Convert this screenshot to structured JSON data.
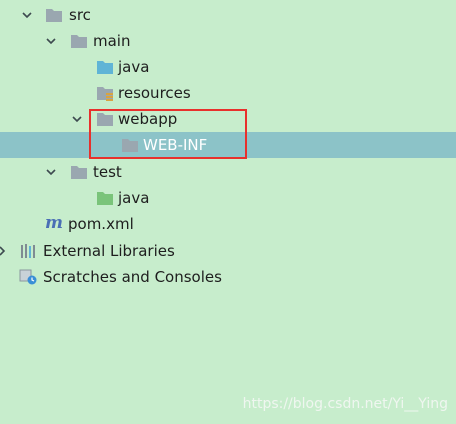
{
  "tree": {
    "items": [
      {
        "label": "src",
        "expanded": true,
        "icon": "folder-icon"
      },
      {
        "label": "main",
        "expanded": true,
        "icon": "folder-icon"
      },
      {
        "label": "java",
        "icon": "source-folder-icon"
      },
      {
        "label": "resources",
        "icon": "resources-folder-icon"
      },
      {
        "label": "webapp",
        "expanded": true,
        "icon": "folder-icon"
      },
      {
        "label": "WEB-INF",
        "icon": "folder-icon",
        "selected": true
      },
      {
        "label": "test",
        "expanded": true,
        "icon": "folder-icon"
      },
      {
        "label": "java",
        "icon": "test-source-folder-icon"
      },
      {
        "label": "pom.xml",
        "icon": "maven-icon"
      },
      {
        "label": "External Libraries",
        "expanded": false,
        "icon": "libraries-icon"
      },
      {
        "label": "Scratches and Consoles",
        "icon": "scratches-icon"
      }
    ]
  },
  "watermark": "https://blog.csdn.net/Yi__Ying",
  "colors": {
    "background": "#c7edcc",
    "selection": "#8cc3c8",
    "highlight_border": "#e8302c",
    "folder": "#9aa7b0",
    "source_folder": "#60b4d6",
    "test_folder": "#7ac47a"
  }
}
